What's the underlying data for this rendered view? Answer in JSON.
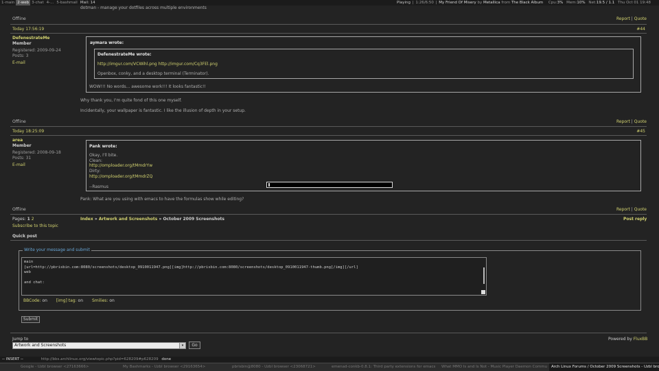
{
  "topbar": {
    "workspaces": [
      "1-main",
      "2-web",
      "3-chat",
      "4-...",
      "5-bashmail"
    ],
    "active_ws": "2-web",
    "mail": "Mail: 14",
    "playing": "Playing",
    "track_time": "1:26/6:50",
    "track": "My Friend Of Misery",
    "by": "by",
    "artist": "Metallica",
    "from": "from",
    "album": "The Black Album",
    "cpu_label": "Cpu:",
    "cpu": "3%",
    "mem_label": "Mem:",
    "mem": "10%",
    "net_label": "Net:",
    "net": "19.5 / 1.1",
    "clock": "Thu Oct 01 19:48"
  },
  "prev_post": {
    "text_top": "dotman - manage your dotfiles across multiple environments",
    "status": "Offline",
    "report": "Report",
    "sep": "|",
    "quote": "Quote"
  },
  "posts": [
    {
      "time": "Today 17:56:19",
      "num": "#44",
      "author": "DefenestrateMe",
      "role": "Member",
      "registered": "Registered: 2009-09-24",
      "posts": "Posts: 3",
      "email": "E-mail",
      "outer_quote_title": "aymara wrote:",
      "inner_quote_title": "DefenestrateMe wrote:",
      "inner_link1": "http://imgur.com/VCWihl.png",
      "inner_link2": "http://imgur.com/Cq3FEl.png",
      "inner_text": "Openbox, conky, and a desktop terminal (Terminator).",
      "outer_quote_text": "WOW!!! No words... awesome work!!! It looks fantastic!!",
      "body1": "Why thank you, I'm quite fond of this one myself.",
      "body2": "Incidentally, your wallpaper is fantastic. I like the illusion of depth in your setup.",
      "status": "Offline",
      "report": "Report",
      "quote": "Quote"
    },
    {
      "time": "Today 18:25:09",
      "num": "#45",
      "author": "area",
      "role": "Member",
      "registered": "Registered: 2008-09-18",
      "posts": "Posts: 31",
      "email": "E-mail",
      "quote_title": "Pank wrote:",
      "q_line1": "Okay, I'll bite.",
      "q_line2": "Clean:",
      "q_link1": "http://omploader.org/tMmdrYw",
      "q_line3": "Dirty:",
      "q_link2": "http://omploader.org/tMmdrZQ",
      "q_sig": "--Rasmus",
      "body": "Pank: What are you using with emacs to have the formulas show while editing?",
      "status": "Offline",
      "report": "Report",
      "quote": "Quote"
    }
  ],
  "pagination": {
    "pages_label": "Pages:",
    "page1": "1",
    "page2": "2",
    "crumb_index": "Index",
    "crumb_sep": "»",
    "crumb_forum": "Artwork and Screenshots",
    "crumb_topic": "October 2009 Screenshots",
    "post_reply": "Post reply",
    "subscribe": "Subscribe to this topic"
  },
  "quickpost": {
    "heading": "Quick post",
    "legend": "Write your message and submit",
    "message_lines": [
      "main",
      "[url=http://pbrisbin.com:8080/screenshots/desktop_0910011947.png][img]http://pbrisbin.com:8080/screenshots/desktop_0910011947-thumb.png[/img][/url]",
      "web",
      "",
      "and chat:"
    ],
    "bbcode_label": "BBCode:",
    "bbcode_val": "on",
    "img_label": "[img] tag:",
    "img_val": "on",
    "smilies_label": "Smilies:",
    "smilies_val": "on",
    "submit": "Submit"
  },
  "footer": {
    "jump_label": "Jump to",
    "jump_value": "Artwork and Screenshots",
    "go": "Go",
    "powered": "Powered by",
    "fluxbb": "FluxBB"
  },
  "statusline": {
    "mode": "-- INSERT --",
    "url": "http://bbs.archlinux.org/viewtopic.php?pid=628209#p628209",
    "state": "done"
  },
  "taskbar": [
    "Google - Uzbl browser <27163666>",
    "My Bashmarks - Uzbl browser <29163654>",
    "pbrisbin@8080 - Uzbl browser <23068721>",
    "emenad-conkb-0.8.1: Third party extensions for emacs",
    "What MMO Is and Is Not - Music Player Daemon Community",
    "Arch Linux Forums / October 2009 Screenshots - Uzbl browser"
  ]
}
